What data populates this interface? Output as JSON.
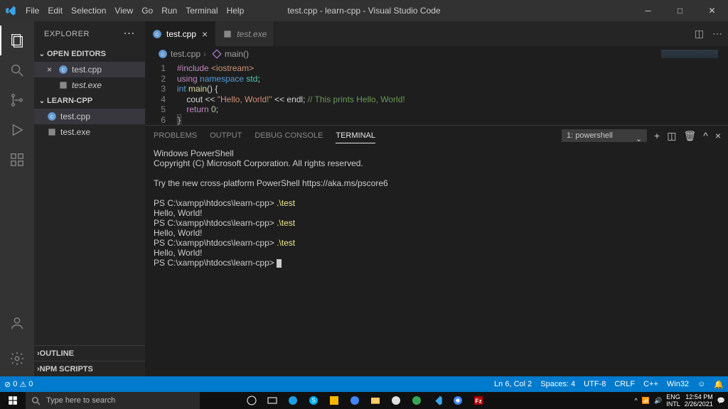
{
  "menu": [
    "File",
    "Edit",
    "Selection",
    "View",
    "Go",
    "Run",
    "Terminal",
    "Help"
  ],
  "window_title": "test.cpp - learn-cpp - Visual Studio Code",
  "explorer": {
    "title": "EXPLORER",
    "open_editors_label": "OPEN EDITORS",
    "workspace_label": "LEARN-CPP",
    "outline_label": "OUTLINE",
    "npm_label": "NPM SCRIPTS",
    "open_editors": [
      {
        "name": "test.cpp",
        "active": true
      },
      {
        "name": "test.exe",
        "active": false
      }
    ],
    "files": [
      {
        "name": "test.cpp",
        "type": "cpp",
        "selected": true
      },
      {
        "name": "test.exe",
        "type": "exe",
        "selected": false
      }
    ]
  },
  "tabs": [
    {
      "name": "test.cpp",
      "active": true
    },
    {
      "name": "test.exe",
      "active": false
    }
  ],
  "breadcrumb": {
    "file": "test.cpp",
    "symbol": "main()"
  },
  "code_lines": [
    1,
    2,
    3,
    4,
    5,
    6
  ],
  "code": {
    "l1_kw": "#include",
    "l1_lib": "<iostream>",
    "l2_kw": "using",
    "l2_kw2": "namespace",
    "l2_ns": "std",
    "l2_end": ";",
    "l3_type": "int",
    "l3_fn": "main",
    "l3_rest": "() {",
    "l4_indent": "    ",
    "l4_cout": "cout",
    "l4_op": " << ",
    "l4_str": "\"Hello, World!\"",
    "l4_op2": " << ",
    "l4_endl": "endl",
    "l4_semi": "; ",
    "l4_comment": "// This prints Hello, World!",
    "l5_indent": "    ",
    "l5_kw": "return",
    "l5_sp": " ",
    "l5_num": "0",
    "l5_semi": ";",
    "l6": "}"
  },
  "panel_tabs": {
    "problems": "PROBLEMS",
    "output": "OUTPUT",
    "debug": "DEBUG CONSOLE",
    "terminal": "TERMINAL"
  },
  "terminal_select": "1: powershell",
  "terminal_lines": [
    "Windows PowerShell",
    "Copyright (C) Microsoft Corporation. All rights reserved.",
    "",
    "Try the new cross-platform PowerShell https://aka.ms/pscore6",
    "",
    "PS C:\\xampp\\htdocs\\learn-cpp> .\\test",
    "Hello, World!",
    "PS C:\\xampp\\htdocs\\learn-cpp> .\\test",
    "Hello, World!",
    "PS C:\\xampp\\htdocs\\learn-cpp> .\\test",
    "Hello, World!",
    "PS C:\\xampp\\htdocs\\learn-cpp> "
  ],
  "status": {
    "errors": "0",
    "warnings": "0",
    "ln_col": "Ln 6, Col 2",
    "spaces": "Spaces: 4",
    "encoding": "UTF-8",
    "eol": "CRLF",
    "lang": "C++",
    "target": "Win32"
  },
  "taskbar": {
    "search_placeholder": "Type here to search",
    "time": "12:54 PM",
    "date": "2/26/2021",
    "lang1": "ENG",
    "lang2": "INTL"
  }
}
